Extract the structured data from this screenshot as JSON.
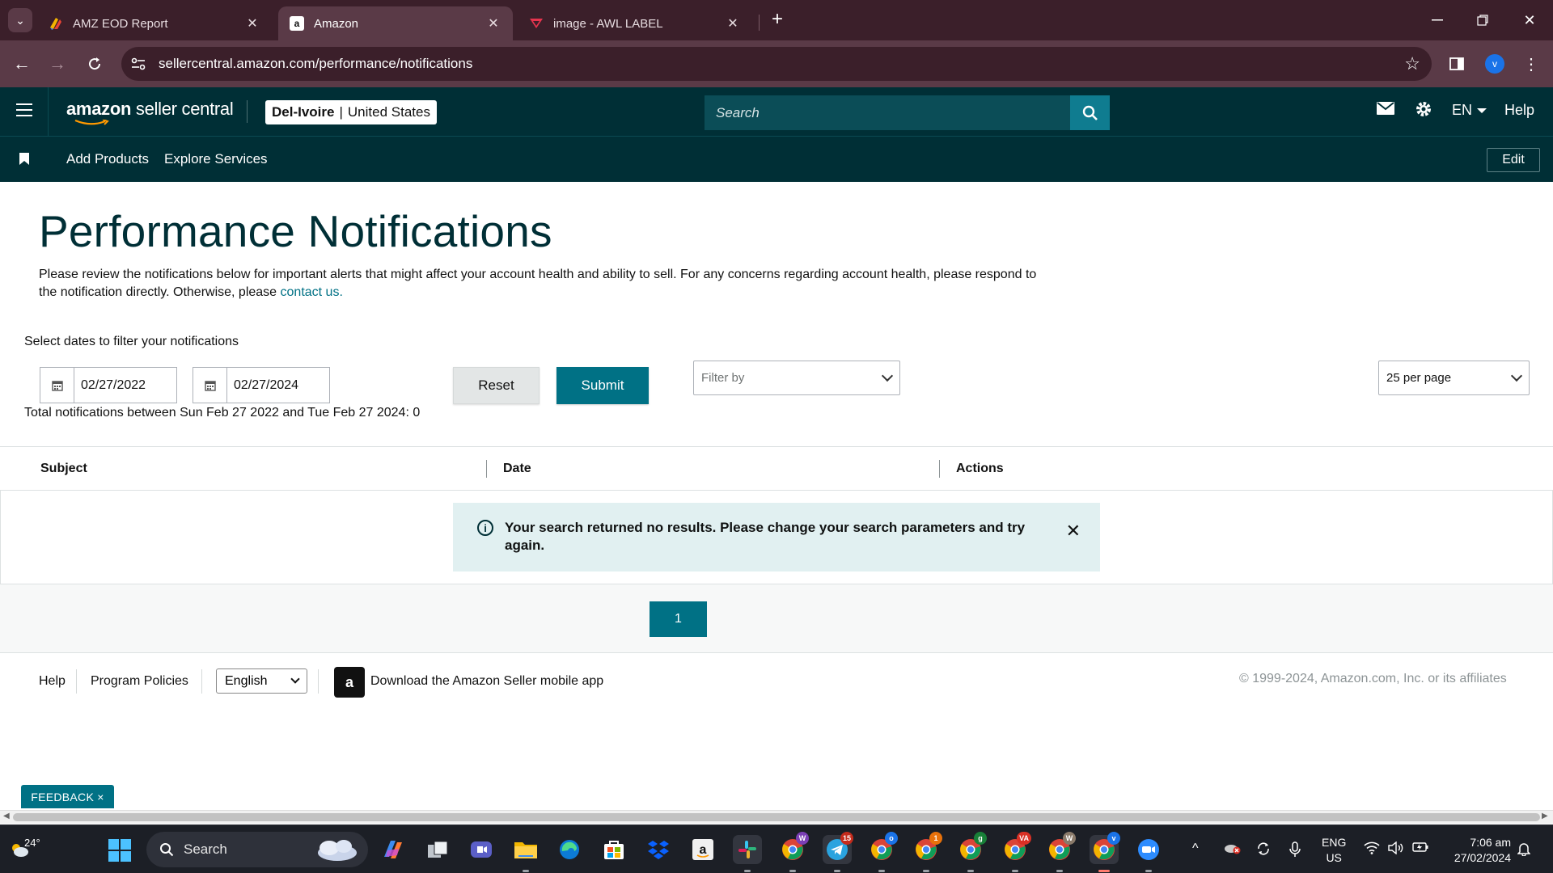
{
  "browser": {
    "tabs": [
      {
        "title": "AMZ EOD Report",
        "active": false
      },
      {
        "title": "Amazon",
        "active": true
      },
      {
        "title": "image - AWL LABEL",
        "active": false
      }
    ],
    "url": "sellercentral.amazon.com/performance/notifications",
    "profile_initial": "v"
  },
  "header": {
    "logo_amazon": "amazon",
    "logo_rest": " seller central",
    "store_name": "Del-Ivoire",
    "store_pipe": "|",
    "store_region": "United States",
    "search_placeholder": "Search",
    "language": "EN",
    "help": "Help"
  },
  "subnav": {
    "links": [
      "Add Products",
      "Explore Services"
    ],
    "edit": "Edit"
  },
  "main": {
    "title": "Performance Notifications",
    "intro": "Please review the notifications below for important alerts that might affect your account health and ability to sell. For any concerns regarding account health, please respond to the notification directly. Otherwise, please ",
    "intro_link": "contact us.",
    "filter_label": "Select dates to filter your notifications",
    "date_from": "02/27/2022",
    "date_to": "02/27/2024",
    "total_line": "Total notifications between Sun Feb 27 2022 and Tue Feb 27 2024: 0",
    "reset": "Reset",
    "submit": "Submit",
    "filter_by": "Filter by",
    "per_page": "25 per page",
    "columns": [
      "Subject",
      "Date",
      "Actions"
    ],
    "alert": "Your search returned no results. Please change your search parameters and try again.",
    "current_page": "1"
  },
  "footer": {
    "help": "Help",
    "program_policies": "Program Policies",
    "language": "English",
    "app_link": "Download the Amazon Seller mobile app",
    "copyright": "© 1999-2024, Amazon.com, Inc. or its affiliates"
  },
  "feedback": "FEEDBACK ×",
  "taskbar": {
    "temperature": "24°",
    "search": "Search",
    "lang_line1": "ENG",
    "lang_line2": "US",
    "time": "7:06 am",
    "date": "27/02/2024",
    "badges": {
      "telegram": "15",
      "chrome_o": "o",
      "chrome_1": "1",
      "chrome_g": "g",
      "chrome_va": "VA",
      "chrome_w2": "W",
      "chrome_v": "v",
      "chrome_w": "W"
    }
  },
  "colors": {
    "header_bg": "#002f36",
    "accent": "#007185",
    "browser_tabbar": "#3b1f2a",
    "browser_toolbar": "#5a3a47",
    "alert_bg": "#e1f0f1"
  }
}
